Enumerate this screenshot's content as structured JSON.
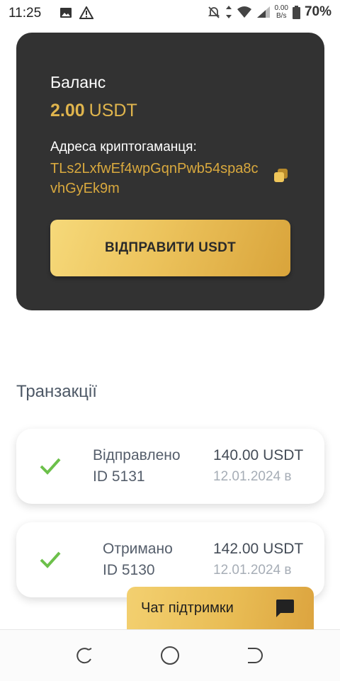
{
  "status_bar": {
    "time": "11:25",
    "net_speed": "0.00",
    "net_unit": "B/s",
    "battery": "70%",
    "icons": [
      "image-icon",
      "warning-icon",
      "mute-icon",
      "data-arrows-icon",
      "wifi-icon",
      "signal-icon",
      "battery-icon"
    ]
  },
  "balance": {
    "label": "Баланс",
    "amount": "2.00",
    "currency": "USDT",
    "address_label": "Адреса криптогаманця:",
    "address": "TLs2LxfwEf4wpGqnPwb54spa8cvhGyEk9m",
    "copy_icon": "copy-icon",
    "send_label": "ВІДПРАВИТИ USDT"
  },
  "transactions": {
    "title": "Транзакції",
    "items": [
      {
        "type": "Відправлено",
        "id": "ID 5131",
        "amount": "140.00 USDT",
        "date": "12.01.2024 в",
        "status_icon": "check-icon"
      },
      {
        "type": "Отримано",
        "id": "ID 5130",
        "amount": "142.00 USDT",
        "date": "12.01.2024 в",
        "status_icon": "check-icon"
      }
    ]
  },
  "chat": {
    "label": "Чат підтримки",
    "icon": "chat-bubble-icon"
  },
  "nav": {
    "icons": [
      "recent-apps-icon",
      "home-icon",
      "back-icon"
    ]
  },
  "colors": {
    "card": "#323232",
    "gold": "#e0b54d",
    "success": "#6cc04a"
  }
}
